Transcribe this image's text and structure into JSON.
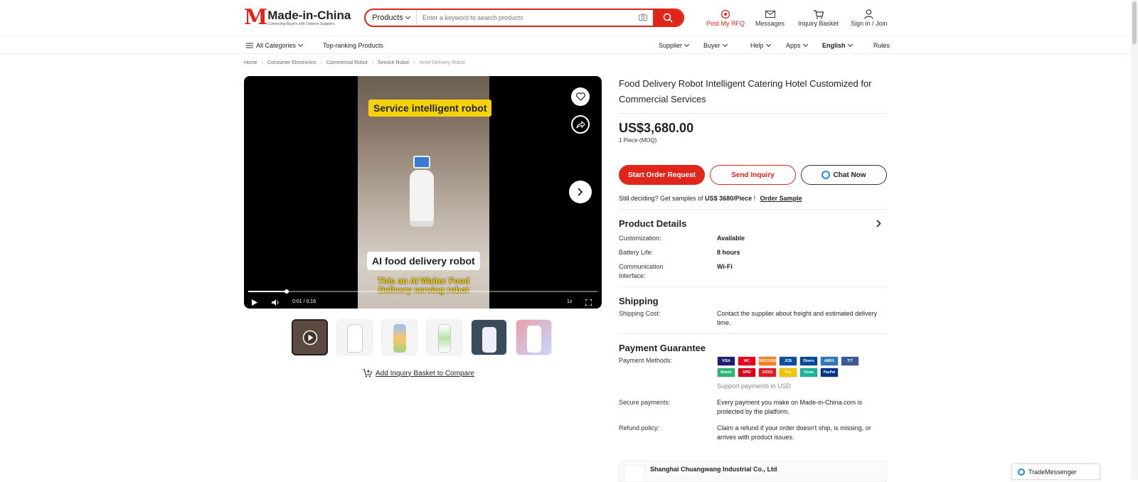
{
  "header": {
    "logo_mark": "M",
    "logo_name": "Made-in-China",
    "logo_tagline": "Connecting Buyers with Chinese Suppliers",
    "search": {
      "category": "Products",
      "placeholder": "Enter a keyword to search products"
    },
    "nav": [
      {
        "label": "Post My RFQ",
        "icon": "rfq-icon"
      },
      {
        "label": "Messages",
        "icon": "mail-icon"
      },
      {
        "label": "Inquiry Basket",
        "icon": "cart-icon"
      },
      {
        "label": "Sign in / Join",
        "icon": "user-icon"
      }
    ]
  },
  "subnav": {
    "all_categories": "All Categories",
    "top_ranking": "Top-ranking Products",
    "supplier": "Supplier",
    "buyer": "Buyer",
    "help": "Help",
    "apps": "Apps",
    "language": "English",
    "rules": "Rules"
  },
  "breadcrumb": [
    "Home",
    "Consumer Electronics",
    "Commercial Robot",
    "Service Robot",
    "Hotel Delivery Robot"
  ],
  "video": {
    "caption_top": "Service intelligent robot",
    "caption_mid": "AI food delivery robot",
    "caption_bottom": "This an AI Waiter Food Delivery serving robot",
    "time": "0:01 / 0:16",
    "speed": "1x",
    "progress": 0.11
  },
  "actions": {
    "add_basket": "Add Inquiry Basket to Compare"
  },
  "product": {
    "title": "Food Delivery Robot Intelligent Catering Hotel Customized for Commercial Services",
    "price": "US$3,680.00",
    "moq": "1 Piece (MOQ)",
    "btn_order": "Start Order Request",
    "btn_inquiry": "Send Inquiry",
    "btn_chat": "Chat Now",
    "samples_prefix": "Still deciding? Get samples of ",
    "samples_price": "US$ 3680/Piece",
    "samples_bang": " !",
    "samples_link": "Order Sample"
  },
  "details": {
    "title": "Product Details",
    "rows": [
      {
        "k": "Customization:",
        "v": "Available"
      },
      {
        "k": "Battery Life:",
        "v": "8 hours"
      },
      {
        "k": "Communication Interface:",
        "v": "Wi-Fi"
      }
    ]
  },
  "shipping": {
    "title": "Shipping",
    "cost_label": "Shipping Cost:",
    "cost_value": "Contact the supplier about freight and estimated delivery time."
  },
  "payment": {
    "title": "Payment Guarantee",
    "methods_label": "Payment Methods:",
    "methods": [
      {
        "name": "VISA",
        "color": "#1a1f71"
      },
      {
        "name": "MC",
        "color": "#eb001b"
      },
      {
        "name": "DISCOVER",
        "color": "#f58220"
      },
      {
        "name": "JCB",
        "color": "#0b4ea2"
      },
      {
        "name": "Diners",
        "color": "#004a97"
      },
      {
        "name": "AMEX",
        "color": "#2e77bc"
      },
      {
        "name": "T/T",
        "color": "#3b5998"
      },
      {
        "name": "Boleto",
        "color": "#2bb673"
      },
      {
        "name": "SPEI",
        "color": "#d6001c"
      },
      {
        "name": "OXXO",
        "color": "#e31b23"
      },
      {
        "name": "Pse",
        "color": "#f2c400"
      },
      {
        "name": "Ozow",
        "color": "#1ab394"
      },
      {
        "name": "PayPal",
        "color": "#003087"
      }
    ],
    "support_note": "Support payments in USD",
    "secure_label": "Secure payments:",
    "secure_value": "Every payment you make on Made-in-China.com is protected by the platform.",
    "refund_label": "Refund policy:",
    "refund_value": "Claim a refund if your order doesn't ship, is missing, or arrives with product issues."
  },
  "supplier": {
    "name": "Shanghai Chuangwang Industrial Co., Ltd"
  },
  "trade_messenger": "TradeMessenger",
  "colors": {
    "brand_red": "#e1251b"
  }
}
